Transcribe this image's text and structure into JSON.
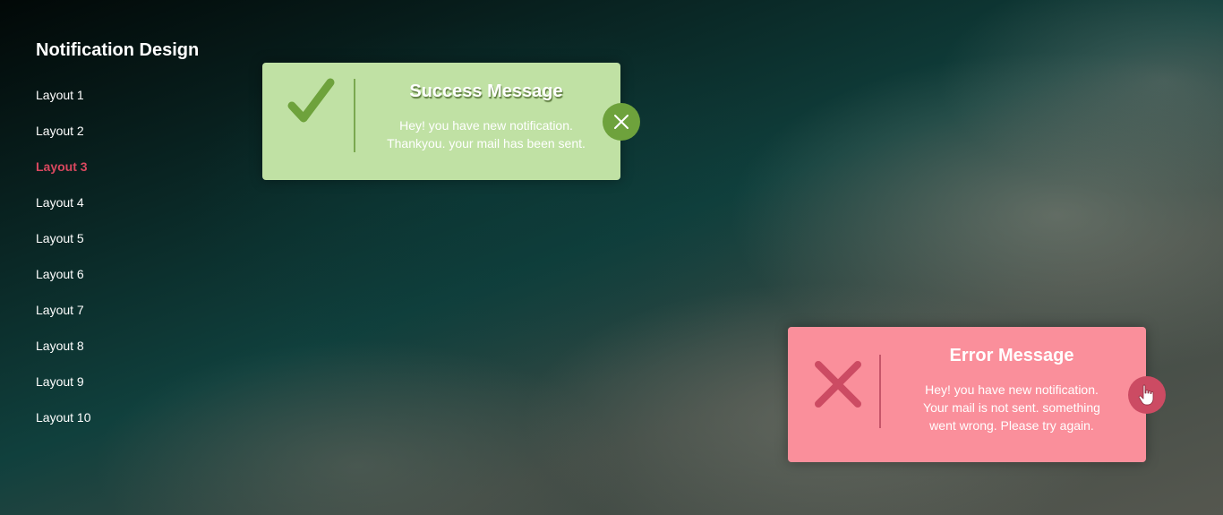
{
  "sidebar": {
    "title": "Notification Design",
    "items": [
      {
        "label": "Layout 1"
      },
      {
        "label": "Layout 2"
      },
      {
        "label": "Layout 3",
        "active": true
      },
      {
        "label": "Layout 4"
      },
      {
        "label": "Layout 5"
      },
      {
        "label": "Layout 6"
      },
      {
        "label": "Layout 7"
      },
      {
        "label": "Layout 8"
      },
      {
        "label": "Layout 9"
      },
      {
        "label": "Layout 10"
      }
    ]
  },
  "success": {
    "title": "Success Message",
    "line1": "Hey! you have new notification.",
    "line2": "Thankyou. your mail has been sent.",
    "icon": "check-icon",
    "close_icon": "close-icon",
    "color": "#c0e1a4",
    "accent": "#6ea23c"
  },
  "error": {
    "title": "Error Message",
    "line1": "Hey! you have new notification.",
    "line2": "Your mail is not sent. something",
    "line3": "went wrong. Please try again.",
    "icon": "cross-icon",
    "close_icon": "pointer-hand-icon",
    "color": "#fa8f9b",
    "accent": "#cc4b63"
  },
  "colors": {
    "active_menu": "#d9485f",
    "text": "#ffffff"
  }
}
